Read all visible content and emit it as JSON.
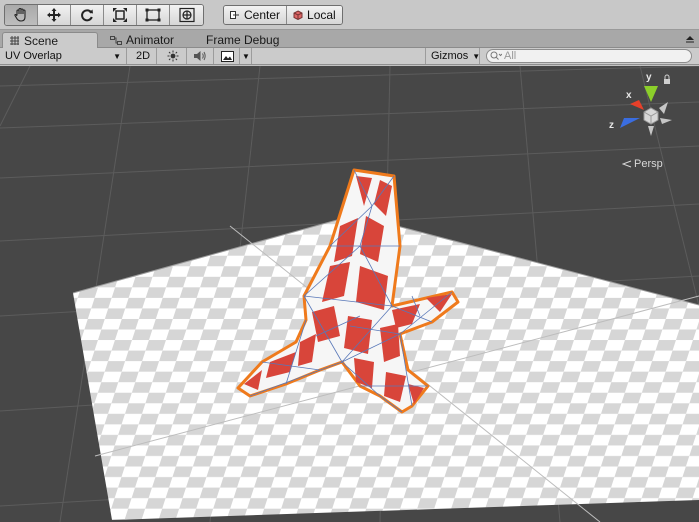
{
  "toolbar": {
    "tools": [
      {
        "name": "hand-tool",
        "active": true
      },
      {
        "name": "move-tool",
        "active": false
      },
      {
        "name": "rotate-tool",
        "active": false
      },
      {
        "name": "scale-tool",
        "active": false
      },
      {
        "name": "rect-tool",
        "active": false
      },
      {
        "name": "transform-tool",
        "active": false
      }
    ],
    "pivot_center_label": "Center",
    "pivot_local_label": "Local"
  },
  "tabs": [
    {
      "label": "Scene",
      "icon": "scene-icon",
      "active": true
    },
    {
      "label": "Animator",
      "icon": "animator-icon",
      "active": false
    },
    {
      "label": "Frame Debug",
      "icon": "",
      "active": false
    }
  ],
  "scene_bar": {
    "draw_mode": "UV Overlap",
    "mode_2d": "2D",
    "gizmos_label": "Gizmos",
    "search_placeholder": "All"
  },
  "viewport": {
    "projection_label": "Persp",
    "axis_labels": {
      "x": "x",
      "y": "y",
      "z": "z"
    },
    "colors": {
      "background": "#474747",
      "grid": "#5a5a5a",
      "mesh_red": "#d8453a",
      "mesh_white": "#f4f4f4",
      "selection_outline": "#ef7a1c",
      "wire": "#5877b8",
      "axis_x": "#e8402a",
      "axis_y": "#8ccf2a",
      "axis_z": "#3a6de0"
    }
  }
}
